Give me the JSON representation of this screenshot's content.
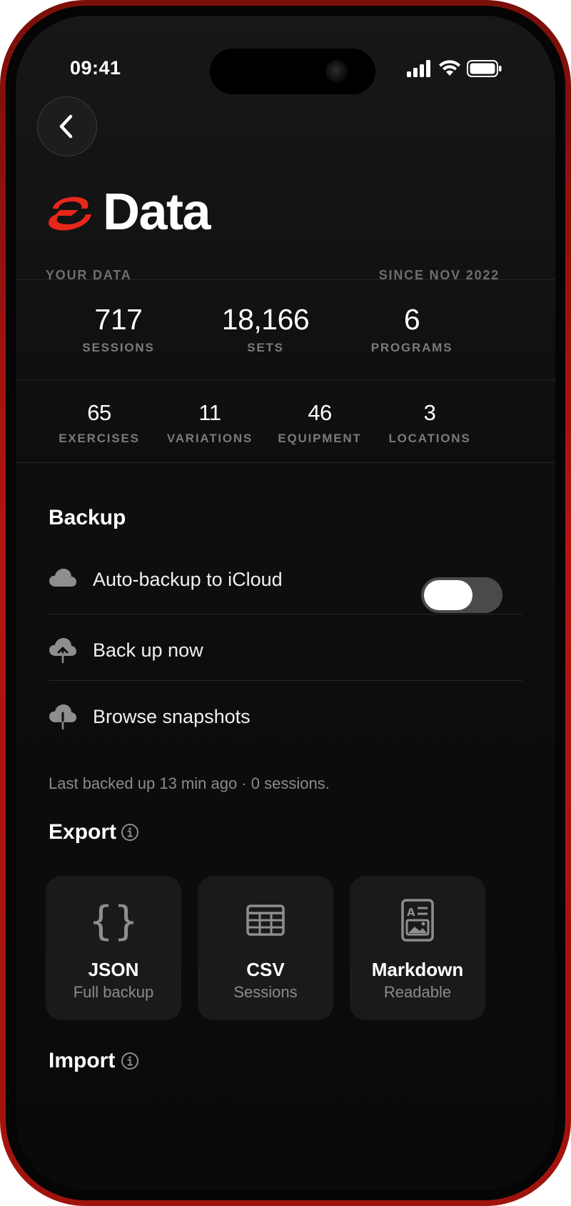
{
  "status_bar": {
    "time": "09:41"
  },
  "header": {
    "title": "Data",
    "your_data_label": "YOUR DATA",
    "since_label": "SINCE NOV 2022"
  },
  "stats_primary": [
    {
      "value": "717",
      "label": "SESSIONS"
    },
    {
      "value": "18,166",
      "label": "SETS"
    },
    {
      "value": "6",
      "label": "PROGRAMS"
    }
  ],
  "stats_secondary": [
    {
      "value": "65",
      "label": "EXERCISES"
    },
    {
      "value": "11",
      "label": "VARIATIONS"
    },
    {
      "value": "46",
      "label": "EQUIPMENT"
    },
    {
      "value": "3",
      "label": "LOCATIONS"
    }
  ],
  "backup": {
    "heading": "Backup",
    "auto_backup_label": "Auto-backup to iCloud",
    "auto_backup_on": false,
    "back_up_now_label": "Back up now",
    "browse_snapshots_label": "Browse snapshots",
    "last_backup_note": "Last backed up 13 min ago · 0 sessions."
  },
  "export": {
    "heading": "Export",
    "options": [
      {
        "title": "JSON",
        "subtitle": "Full backup",
        "icon": "braces-icon"
      },
      {
        "title": "CSV",
        "subtitle": "Sessions",
        "icon": "table-icon"
      },
      {
        "title": "Markdown",
        "subtitle": "Readable",
        "icon": "document-icon"
      }
    ]
  },
  "import": {
    "heading": "Import"
  },
  "colors": {
    "brand_red": "#e8271c",
    "frame_red": "#b3150f",
    "background": "#0e0e0e",
    "card": "#1a1a1a",
    "muted_text": "#7a7a7a"
  }
}
